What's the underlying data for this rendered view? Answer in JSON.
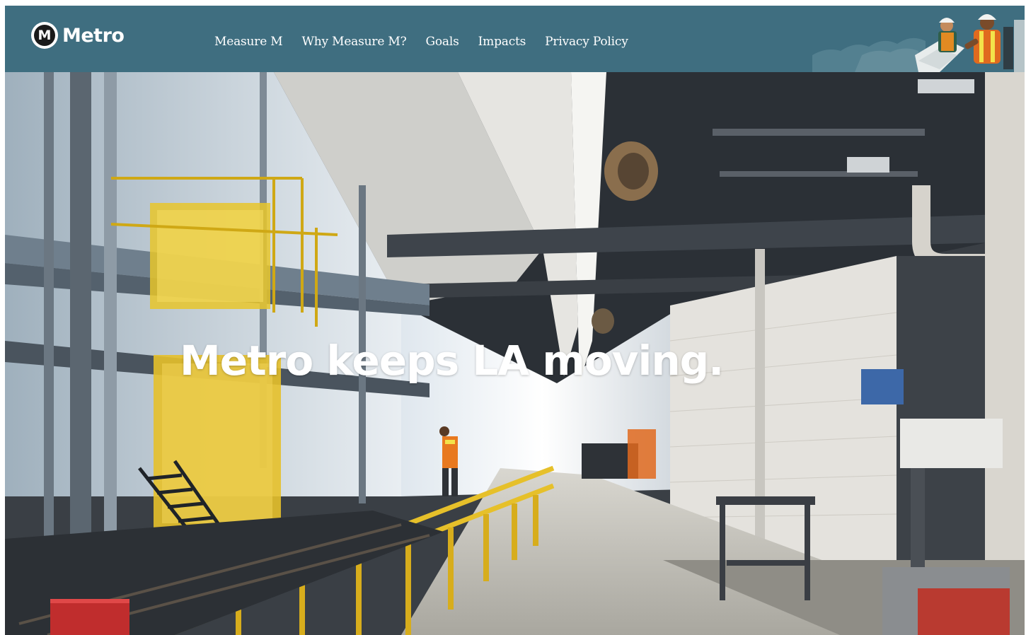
{
  "brand": {
    "logo_letter": "M",
    "name": "Metro"
  },
  "nav": {
    "items": [
      {
        "label": "Measure M"
      },
      {
        "label": "Why Measure M?"
      },
      {
        "label": "Goals"
      },
      {
        "label": "Impacts"
      },
      {
        "label": "Privacy Policy"
      }
    ]
  },
  "hero": {
    "headline": "Metro keeps LA moving."
  },
  "colors": {
    "header_bg": "#3f6e80",
    "text": "#ffffff",
    "accent_yellow": "#e8c52a"
  },
  "icons": {
    "logo": "metro-logo-icon",
    "worker_illustration": "worker-illustration-icon"
  }
}
